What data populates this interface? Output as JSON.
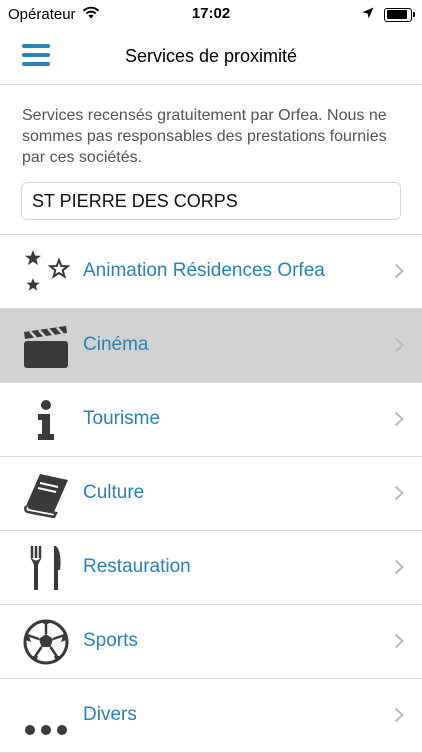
{
  "status_bar": {
    "carrier": "Opérateur",
    "time": "17:02"
  },
  "nav": {
    "title": "Services de proximité"
  },
  "notice": {
    "text": "Services recensés gratuitement par Orfea. Nous ne sommes pas responsables des prestations fournies par ces sociétés."
  },
  "search": {
    "value": "ST PIERRE DES CORPS"
  },
  "colors": {
    "accent": "#2a84b3",
    "selected_row": "#d2d2d2",
    "icon": "#3a3a3a"
  },
  "list": {
    "items": [
      {
        "label": "Animation Résidences Orfea",
        "icon": "stars-icon"
      },
      {
        "label": "Cinéma",
        "icon": "clapperboard-icon",
        "selected": true
      },
      {
        "label": "Tourisme",
        "icon": "info-icon"
      },
      {
        "label": "Culture",
        "icon": "book-icon"
      },
      {
        "label": "Restauration",
        "icon": "fork-knife-icon"
      },
      {
        "label": "Sports",
        "icon": "soccer-ball-icon"
      },
      {
        "label": "Divers",
        "icon": "ellipsis-icon"
      }
    ]
  }
}
